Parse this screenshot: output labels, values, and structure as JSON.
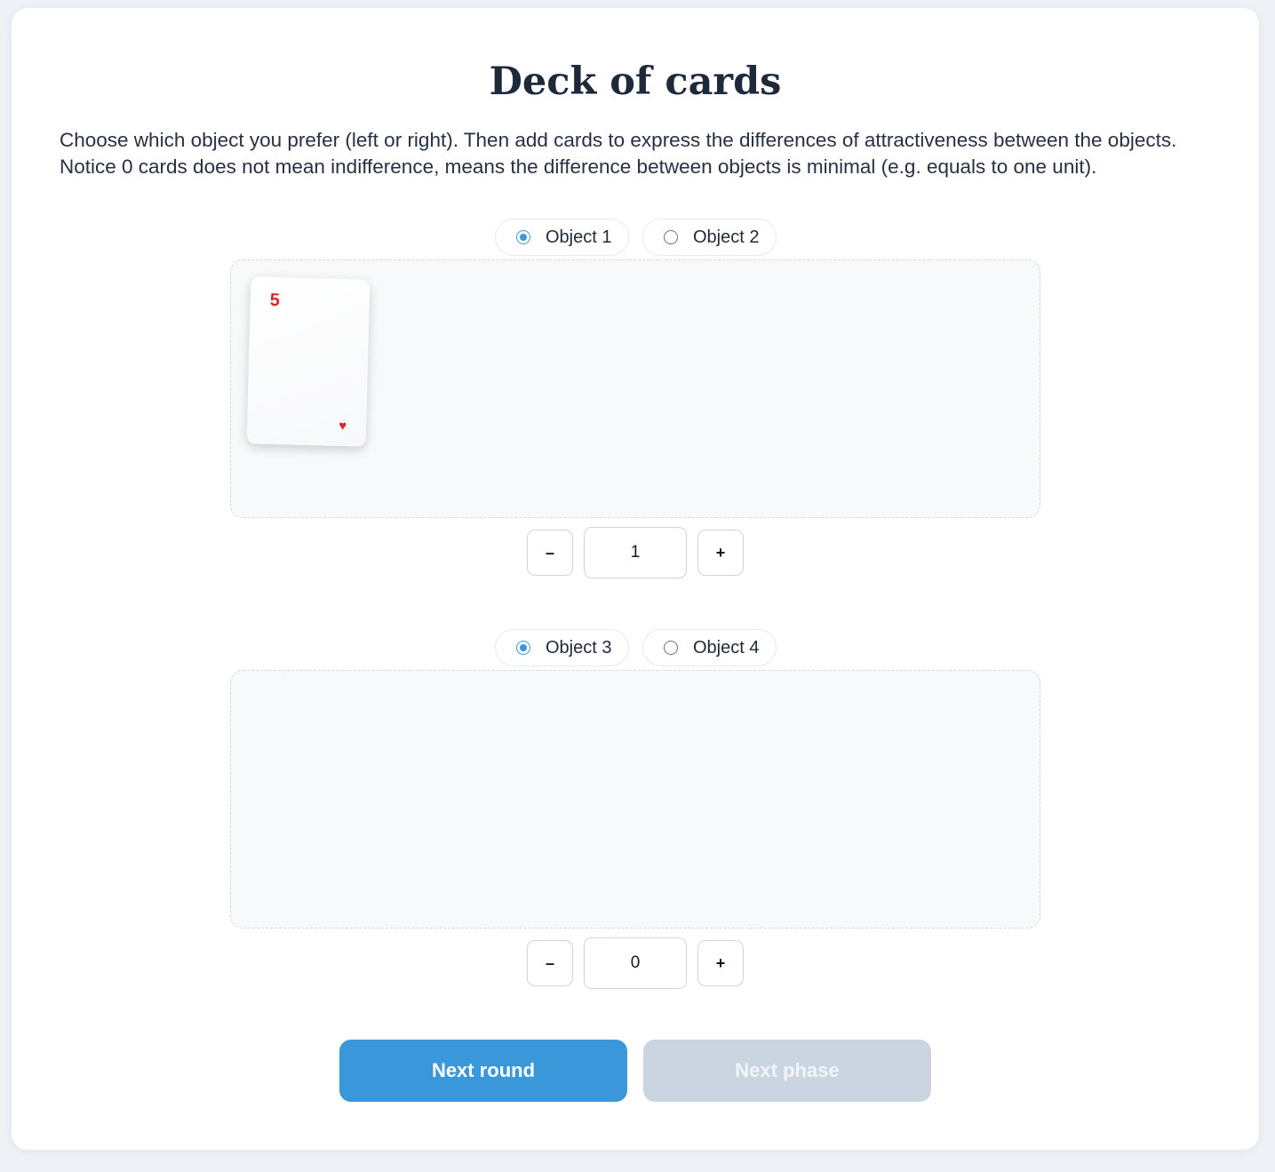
{
  "page": {
    "title": "Deck of cards",
    "instructions": "Choose which object you prefer (left or right). Then add cards to express the differences of attractiveness between the objects. Notice 0 cards does not mean indifference, means the difference between objects is minimal (e.g. equals to one unit)."
  },
  "comparisons": [
    {
      "left_option": "Object 1",
      "right_option": "Object 2",
      "selected": "left",
      "cards": [
        {
          "rank": "5",
          "suit": "♥"
        }
      ],
      "count": "1",
      "decrement_label": "–",
      "increment_label": "+"
    },
    {
      "left_option": "Object 3",
      "right_option": "Object 4",
      "selected": "left",
      "cards": [],
      "count": "0",
      "decrement_label": "–",
      "increment_label": "+"
    }
  ],
  "actions": {
    "next_round": "Next round",
    "next_phase": "Next phase",
    "next_phase_disabled": true
  },
  "colors": {
    "accent": "#3a97da",
    "card_red": "#dc2626",
    "disabled": "#cbd5e1"
  }
}
